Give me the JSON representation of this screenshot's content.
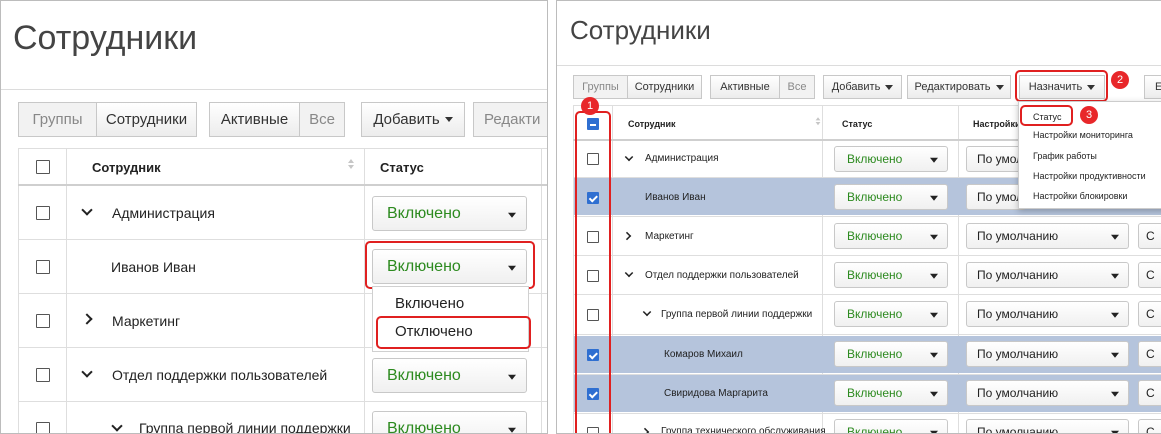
{
  "left": {
    "title": "Сотрудники",
    "toolbar": {
      "groups": "Группы",
      "employees": "Сотрудники",
      "active": "Активные",
      "all": "Все",
      "add": "Добавить",
      "edit": "Редакти"
    },
    "table": {
      "col_employee": "Сотрудник",
      "col_status": "Статус",
      "rows": [
        {
          "name": "Администрация",
          "status": "Включено"
        },
        {
          "name": "Иванов Иван",
          "status": "Включено"
        },
        {
          "name": "Маркетинг",
          "status": ""
        },
        {
          "name": "Отдел поддержки пользователей",
          "status": "Включено"
        },
        {
          "name": "Группа первой линии поддержки",
          "status": "Включено"
        }
      ]
    },
    "status_dropdown": {
      "options": [
        "Включено",
        "Отключено"
      ]
    }
  },
  "right": {
    "title": "Сотрудники",
    "toolbar": {
      "groups": "Группы",
      "employees": "Сотрудники",
      "active": "Активные",
      "all": "Все",
      "add": "Добавить",
      "edit": "Редактировать",
      "assign": "Назначить",
      "extra": "Е"
    },
    "table": {
      "col_employee": "Сотрудник",
      "col_status": "Статус",
      "col_settings": "Настройки",
      "rows": [
        {
          "name": "Администрация",
          "status": "Включено",
          "settings": "По умол",
          "c": ""
        },
        {
          "name": "Иванов Иван",
          "status": "Включено",
          "settings": "По умол",
          "c": ""
        },
        {
          "name": "Маркетинг",
          "status": "Включено",
          "settings": "По умолчанию",
          "c": "С"
        },
        {
          "name": "Отдел поддержки пользователей",
          "status": "Включено",
          "settings": "По умолчанию",
          "c": "С"
        },
        {
          "name": "Группа первой линии поддержки",
          "status": "Включено",
          "settings": "По умолчанию",
          "c": "С"
        },
        {
          "name": "Комаров Михаил",
          "status": "Включено",
          "settings": "По умолчанию",
          "c": "С"
        },
        {
          "name": "Свиридова Маргарита",
          "status": "Включено",
          "settings": "По умолчанию",
          "c": "С"
        },
        {
          "name": "Группа технического обслуживания",
          "status": "Включено",
          "settings": "По умолчанию",
          "c": "С"
        }
      ]
    },
    "assign_menu": {
      "items": [
        "Статус",
        "Настройки мониторинга",
        "График работы",
        "Настройки продуктивности",
        "Настройки блокировки"
      ]
    },
    "badges": [
      "1",
      "2",
      "3"
    ]
  },
  "colors": {
    "selected_row": "#b5c4dc",
    "highlight": "#e02020",
    "status_green": "#2c8a1f",
    "checkbox_blue": "#2f6fd1"
  }
}
